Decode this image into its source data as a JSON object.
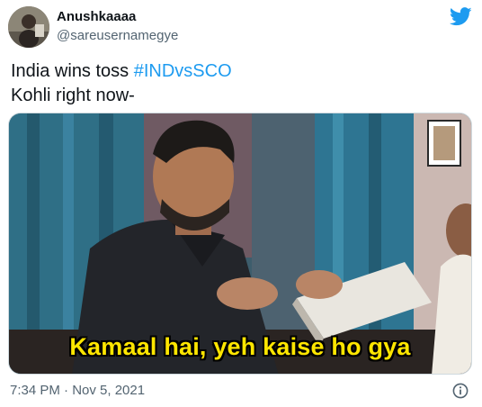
{
  "tweet": {
    "author_name": "Anushkaaaa",
    "author_handle": "@sareusernamegye",
    "text_line1_prefix": "India wins toss ",
    "hashtag": "#INDvsSCO",
    "text_line2": "Kohli right now-",
    "timestamp": "7:34 PM · Nov 5, 2021"
  },
  "media": {
    "subtitle": "Kamaal hai, yeh kaise ho gya"
  },
  "icons": {
    "brand": "twitter-bird-icon",
    "info": "info-icon"
  },
  "colors": {
    "hashtag": "#1d9bf0",
    "twitter_blue": "#1d9bf0",
    "meta_text": "#536471",
    "subtitle": "#ffe600"
  }
}
